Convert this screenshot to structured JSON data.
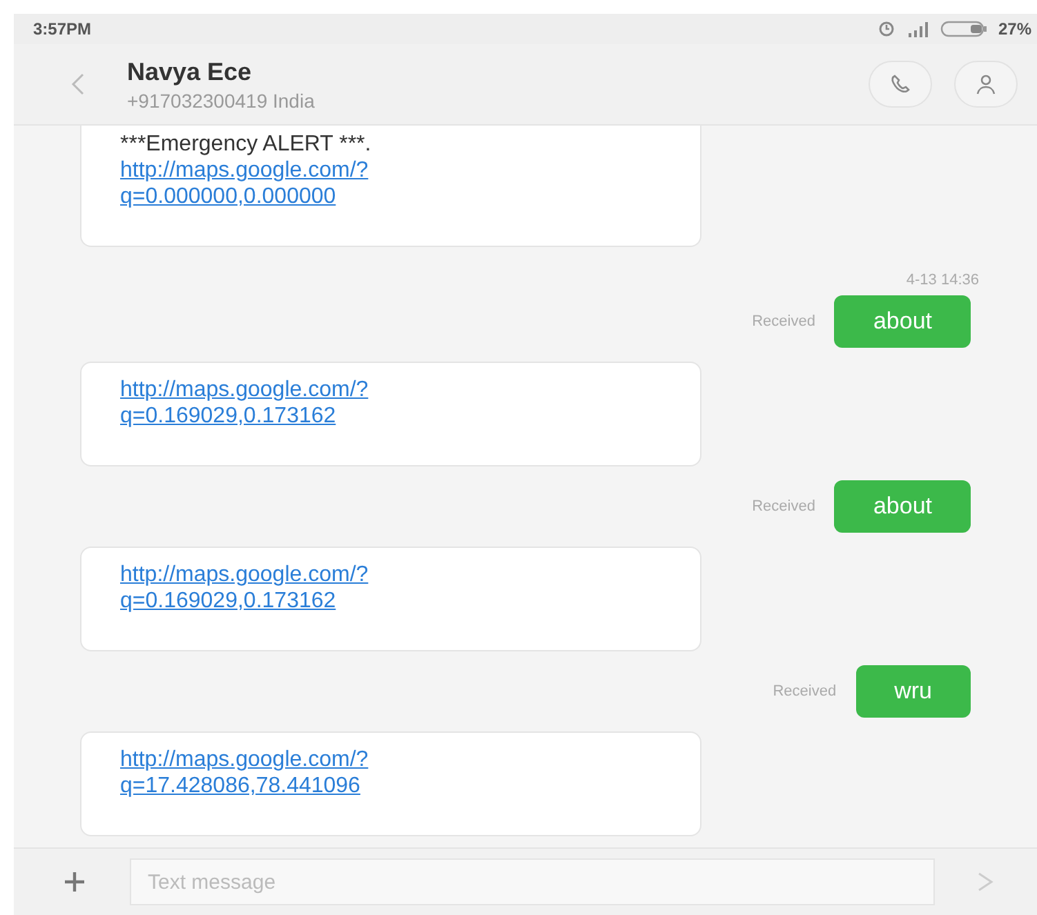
{
  "status_bar": {
    "time": "3:57PM",
    "battery": "27%"
  },
  "header": {
    "name": "Navya Ece",
    "subtitle": "+917032300419 India"
  },
  "messages": [
    {
      "kind": "incoming",
      "cut_top": true,
      "parts": [
        {
          "kind": "text",
          "text": "***Emergency ALERT ***."
        },
        {
          "kind": "link",
          "text": "http://maps.google.com/?"
        },
        {
          "kind": "link",
          "text": "q=0.000000,0.000000"
        }
      ]
    },
    {
      "kind": "outgoing",
      "timestamp": "4-13 14:36",
      "status": "Received",
      "text": "about"
    },
    {
      "kind": "incoming",
      "cut_top": false,
      "parts": [
        {
          "kind": "link",
          "text": "http://maps.google.com/?"
        },
        {
          "kind": "link",
          "text": "q=0.169029,0.173162"
        }
      ]
    },
    {
      "kind": "outgoing",
      "status": "Received",
      "text": "about"
    },
    {
      "kind": "incoming",
      "cut_top": false,
      "parts": [
        {
          "kind": "link",
          "text": "http://maps.google.com/?"
        },
        {
          "kind": "link",
          "text": "q=0.169029,0.173162"
        }
      ]
    },
    {
      "kind": "outgoing",
      "status": "Received",
      "text": "wru"
    },
    {
      "kind": "incoming",
      "cut_top": false,
      "parts": [
        {
          "kind": "link",
          "text": "http://maps.google.com/?"
        },
        {
          "kind": "link",
          "text": "q=17.428086,78.441096"
        }
      ]
    }
  ],
  "composer": {
    "placeholder": "Text message"
  }
}
